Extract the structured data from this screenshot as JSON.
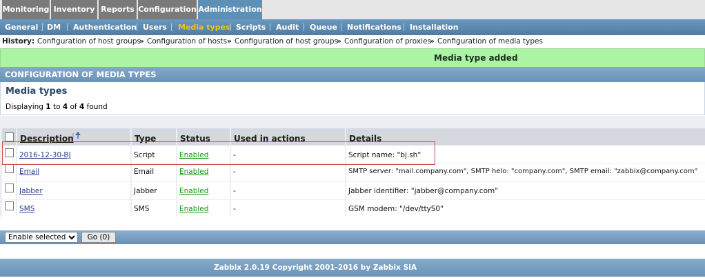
{
  "topnav": {
    "tabs": [
      {
        "label": "Monitoring"
      },
      {
        "label": "Inventory"
      },
      {
        "label": "Reports"
      },
      {
        "label": "Configuration"
      },
      {
        "label": "Administration"
      }
    ]
  },
  "subnav": {
    "items": [
      {
        "label": "General"
      },
      {
        "label": "DM"
      },
      {
        "label": "Authentication"
      },
      {
        "label": "Users"
      },
      {
        "label": "Media types"
      },
      {
        "label": "Scripts"
      },
      {
        "label": "Audit"
      },
      {
        "label": "Queue"
      },
      {
        "label": "Notifications"
      },
      {
        "label": "Installation"
      }
    ],
    "active_color": "#f0c418"
  },
  "history": {
    "label": "History:",
    "links": [
      "Configuration of host groups",
      "Configuration of hosts",
      "Configuration of host groups",
      "Configuration of proxies",
      "Configuration of media types"
    ],
    "separator": "»"
  },
  "notice": {
    "message": "Media type added",
    "color": "#aaf4a4"
  },
  "section_header": "CONFIGURATION OF MEDIA TYPES",
  "media_types": {
    "title": "Media types",
    "displaying_prefix": "Displaying",
    "from": "1",
    "to_word": "to",
    "to": "4",
    "of_word": "of",
    "total": "4",
    "found_word": "found"
  },
  "table": {
    "columns": [
      "Description",
      "Type",
      "Status",
      "Used in actions",
      "Details"
    ],
    "sort_icon": "sort-up-arrow-icon",
    "rows": [
      {
        "description": "2016-12-30-BJ",
        "type": "Script",
        "status": "Enabled",
        "used": "-",
        "details": "Script name: \"bj.sh\""
      },
      {
        "description": "Email",
        "type": "Email",
        "status": "Enabled",
        "used": "-",
        "details": "SMTP server: \"mail.company.com\", SMTP helo: \"company.com\", SMTP email: \"zabbix@company.com\""
      },
      {
        "description": "Jabber",
        "type": "Jabber",
        "status": "Enabled",
        "used": "-",
        "details": "Jabber identifier: \"jabber@company.com\""
      },
      {
        "description": "SMS",
        "type": "SMS",
        "status": "Enabled",
        "used": "-",
        "details": "GSM modem: \"/dev/ttyS0\""
      }
    ]
  },
  "actions": {
    "select_value": "Enable selected",
    "go_label": "Go (0)"
  },
  "footer": {
    "copyright": "Zabbix 2.0.19 Copyright 2001-2016 by Zabbix SIA"
  }
}
